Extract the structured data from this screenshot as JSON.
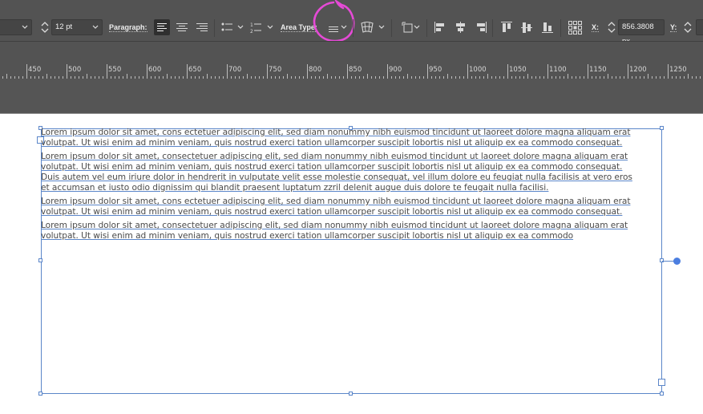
{
  "control_bar": {
    "font_size_value": "12 pt",
    "paragraph_label": "Paragraph:",
    "area_type_label": "Area Type:",
    "x_label": "X:",
    "x_value": "856.3808 px",
    "y_label": "Y:"
  },
  "ruler": {
    "labels": [
      "450",
      "500",
      "550",
      "600",
      "650",
      "700",
      "750",
      "800",
      "850",
      "900",
      "950",
      "1000",
      "1050",
      "1100",
      "1150",
      "1200",
      "1250"
    ]
  },
  "text_frame": {
    "paragraphs": [
      {
        "lines": [
          "Lorem ipsum dolor sit amet, cons ectetuer adipiscing elit, sed diam nonummy nibh euismod tincidunt ut laoreet dolore magna aliquam erat",
          "volutpat. Ut wisi enim ad minim veniam, quis nostrud exerci tation ullamcorper suscipit lobortis nisl ut aliquip ex ea commodo consequat."
        ]
      },
      {
        "lines": [
          "Lorem ipsum dolor sit amet, consectetuer adipiscing elit, sed diam nonummy nibh euismod tincidunt ut laoreet dolore magna aliquam erat",
          "volutpat. Ut wisi enim ad minim veniam, quis nostrud exerci tation ullamcorper suscipit lobortis nisl ut aliquip ex ea commodo consequat.",
          "Duis autem vel eum iriure dolor in hendrerit in vulputate velit esse molestie consequat, vel illum dolore eu feugiat nulla facilisis at vero eros",
          "et accumsan et iusto odio dignissim qui blandit praesent luptatum zzril delenit augue duis dolore te feugait nulla facilisi."
        ]
      },
      {
        "lines": [
          "Lorem ipsum dolor sit amet, cons ectetuer adipiscing elit, sed diam nonummy nibh euismod tincidunt ut laoreet dolore magna aliquam erat",
          "volutpat. Ut wisi enim ad minim veniam, quis nostrud exerci tation ullamcorper suscipit lobortis nisl ut aliquip ex ea commodo consequat."
        ]
      },
      {
        "lines": [
          "Lorem ipsum dolor sit amet, consectetuer adipiscing elit, sed diam nonummy nibh euismod tincidunt ut laoreet dolore magna aliquam erat",
          "volutpat. Ut wisi enim ad minim veniam, quis nostrud exerci tation ullamcorper suscipit lobortis nisl ut aliquip ex ea commodo"
        ]
      }
    ]
  },
  "colors": {
    "ui_background": "#535353",
    "frame_selection": "#5b86c9",
    "annotation": "#e54ad6"
  }
}
